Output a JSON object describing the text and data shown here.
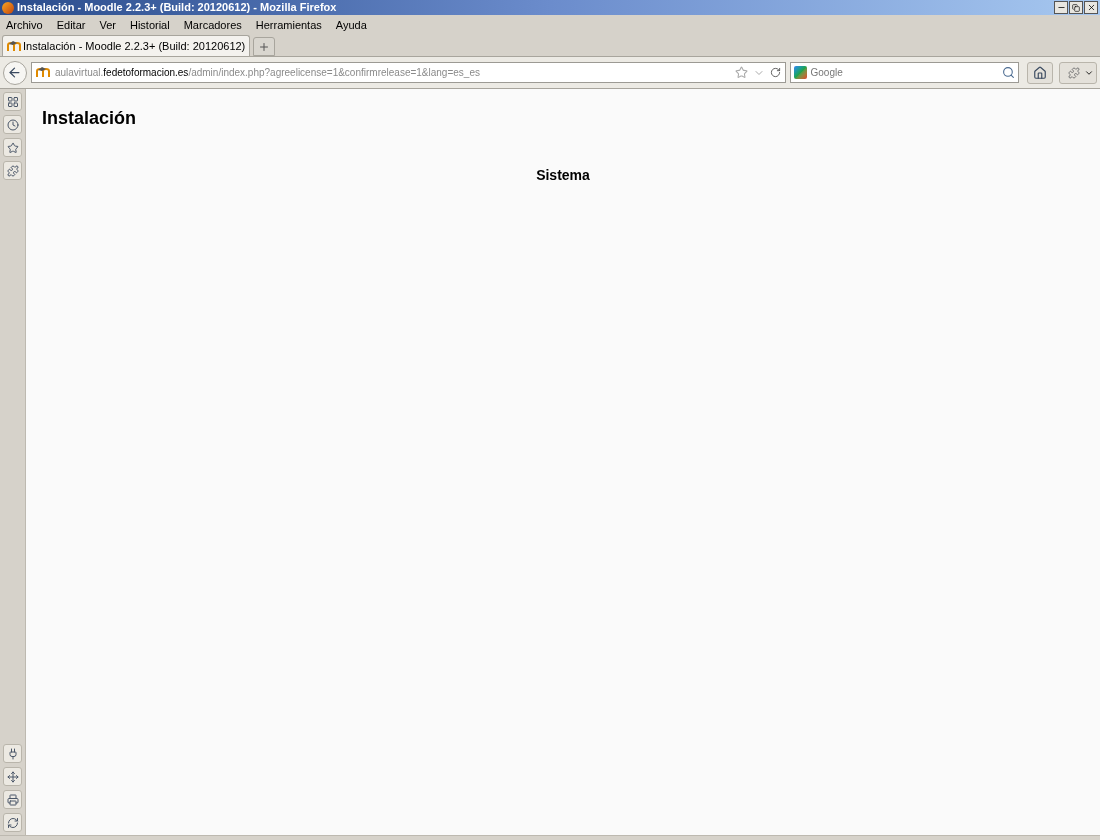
{
  "window": {
    "title": "Instalación - Moodle 2.2.3+ (Build: 20120612) - Mozilla Firefox"
  },
  "menu": [
    "Archivo",
    "Editar",
    "Ver",
    "Historial",
    "Marcadores",
    "Herramientas",
    "Ayuda"
  ],
  "tabs": [
    {
      "label": "Instalación - Moodle 2.2.3+ (Build: 20120612)",
      "selected": true
    }
  ],
  "address_bar": {
    "url_start": "aulavirtual.",
    "url_domain": "fedetoformacion.es",
    "url_rest": "/admin/index.php?agreelicense=1&confirmrelease=1&lang=es_es"
  },
  "search": {
    "placeholder": "Google"
  },
  "page": {
    "heading": "Instalación",
    "section": "Sistema"
  }
}
